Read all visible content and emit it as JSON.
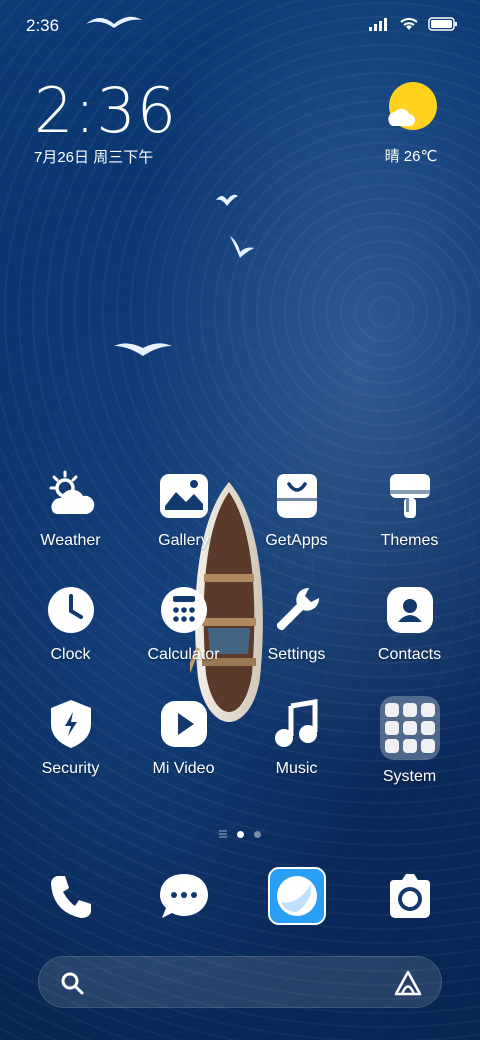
{
  "status": {
    "time": "2:36"
  },
  "clock": {
    "time": "2:36",
    "date": "7月26日 周三下午"
  },
  "weather": {
    "temp": "晴 26℃"
  },
  "apps": [
    {
      "label": "Weather",
      "icon": "weather-icon"
    },
    {
      "label": "Gallery",
      "icon": "gallery-icon"
    },
    {
      "label": "GetApps",
      "icon": "getapps-icon"
    },
    {
      "label": "Themes",
      "icon": "themes-icon"
    },
    {
      "label": "Clock",
      "icon": "clock-icon"
    },
    {
      "label": "Calculator",
      "icon": "calculator-icon"
    },
    {
      "label": "Settings",
      "icon": "settings-icon"
    },
    {
      "label": "Contacts",
      "icon": "contacts-icon"
    },
    {
      "label": "Security",
      "icon": "security-icon"
    },
    {
      "label": "Mi Video",
      "icon": "mi-video-icon"
    },
    {
      "label": "Music",
      "icon": "music-icon"
    },
    {
      "label": "System",
      "icon": "system-folder-icon"
    }
  ],
  "dock": [
    {
      "icon": "phone-icon"
    },
    {
      "icon": "messages-icon"
    },
    {
      "icon": "browser-icon"
    },
    {
      "icon": "camera-icon"
    }
  ],
  "search": {
    "left_icon": "search-icon",
    "right_icon": "assistant-icon"
  },
  "colors": {
    "accent": "#2a9df4",
    "sun": "#ffd21f"
  }
}
